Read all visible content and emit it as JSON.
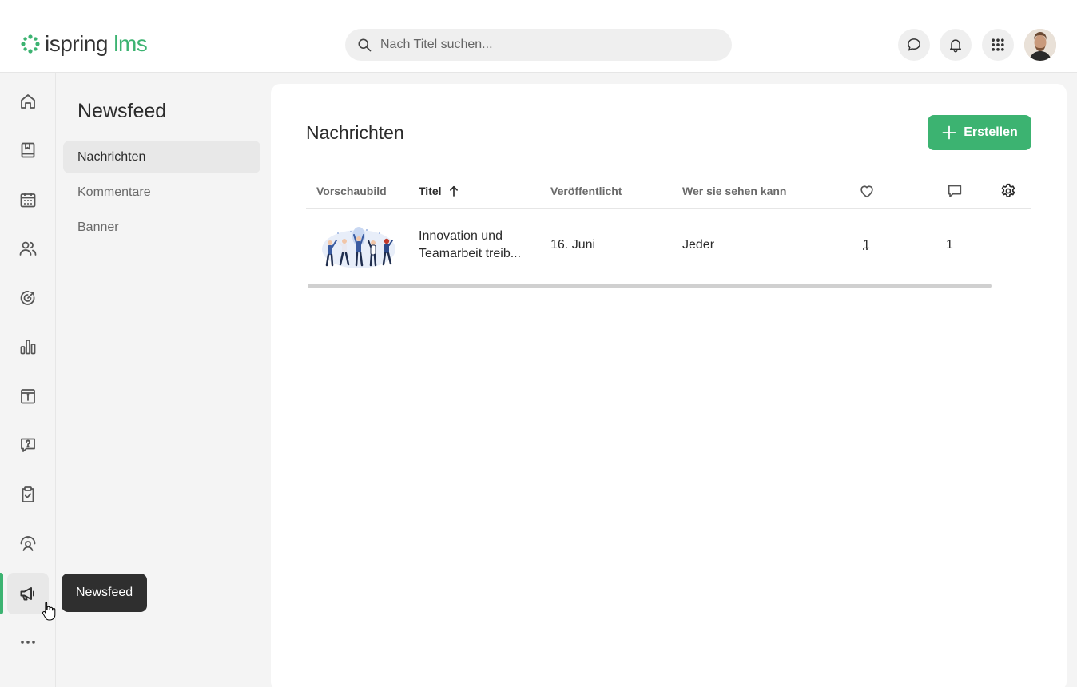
{
  "header": {
    "logo_left": "ispring",
    "logo_right": " lms",
    "search_placeholder": "Nach Titel suchen...",
    "icons": [
      "chat-icon",
      "bell-icon",
      "apps-grid-icon"
    ]
  },
  "rail": {
    "items": [
      "home-icon",
      "book-icon",
      "calendar-icon",
      "users-icon",
      "target-icon",
      "bar-chart-icon",
      "info-book-icon",
      "help-chat-icon",
      "clipboard-check-icon",
      "user-gauge-icon",
      "megaphone-icon",
      "more-icon"
    ],
    "active": "megaphone-icon"
  },
  "subnav": {
    "title": "Newsfeed",
    "items": [
      {
        "label": "Nachrichten",
        "active": true
      },
      {
        "label": "Kommentare",
        "active": false
      },
      {
        "label": "Banner",
        "active": false
      }
    ]
  },
  "tooltip": {
    "text": "Newsfeed"
  },
  "main": {
    "title": "Nachrichten",
    "create_label": "Erstellen",
    "columns": {
      "preview": "Vorschaubild",
      "title": "Titel",
      "published": "Veröffentlicht",
      "audience": "Wer sie sehen kann"
    },
    "rows": [
      {
        "title": "Innovation und Teamarbeit treib...",
        "published": "16. Juni",
        "audience": "Jeder",
        "likes": "1",
        "comments": "1"
      }
    ]
  },
  "colors": {
    "accent": "#3cb371",
    "tooltip_bg": "#2f2f2f"
  }
}
